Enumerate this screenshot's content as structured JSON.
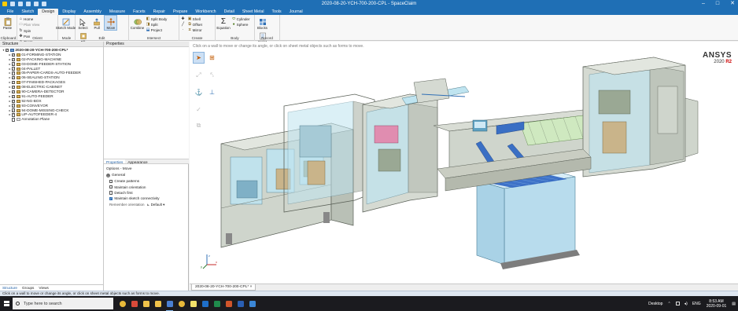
{
  "window": {
    "title": "2020-08-20-YCH-700-200-CPL - SpaceClaim",
    "controls": {
      "minimize": "–",
      "maximize": "□",
      "close": "✕"
    }
  },
  "menu_tabs": [
    "File",
    "Sketch",
    "Design",
    "Display",
    "Assembly",
    "Measure",
    "Facets",
    "Repair",
    "Prepare",
    "Workbench",
    "Detail",
    "Sheet Metal",
    "Tools",
    "Journal"
  ],
  "ribbon": {
    "clipboard": {
      "paste": "Paste",
      "label": "Clipboard"
    },
    "orient": {
      "home": "Home",
      "plan_view": "Plan View",
      "spin": "Spin",
      "pan": "Pan",
      "zoom": "Zoom",
      "label": "Orient"
    },
    "mode": {
      "sketch_mode": "Sketch Mode",
      "label": "Mode"
    },
    "edit": {
      "select": "Select",
      "pull": "Pull",
      "move": "Move",
      "fill": "Fill",
      "label": "Edit"
    },
    "intersect": {
      "combine": "Combine",
      "split_body": "Split Body",
      "split": "Split",
      "project": "Project",
      "label": "Intersect"
    },
    "create": {
      "shell": "Shell",
      "offset": "Offset",
      "mirror": "Mirror",
      "label": "Create"
    },
    "body": {
      "equation": "Equation",
      "cylinder": "Cylinder",
      "sphere": "Sphere",
      "label": "Body"
    },
    "record": {
      "blocks": "Blocks",
      "script": "Script",
      "label": "Record"
    }
  },
  "structure": {
    "header": "Structure",
    "root": "2020-08-20-YCH-700-200-CPL*",
    "items": [
      "01-FORMING-STATION",
      "02-PACKING-MACHINE",
      "03-DOME-FEEDER-STATION",
      "04-PALLET",
      "05-PAPER-CARDS-AUTO-FEEDER",
      "06-SEALING-STATION",
      "07-FINISHED-PACKAGES",
      "08-ELECTRIC-CABINET",
      "90-CAMERA-DETECTOR",
      "91-AUTO-FEEDER",
      "92-NG-BOX",
      "93-CONVEYOR",
      "94-DOME-MISSING-CHECK",
      "LIP-AUTOFEEDER-4"
    ],
    "annotation_plane": "Annotation Plane",
    "bottom_tabs": [
      "Structure",
      "Groups",
      "Views"
    ]
  },
  "properties": {
    "header": "Properties",
    "tabs": [
      "Properties",
      "Appearance"
    ],
    "options_title": "Options - Move",
    "general": "General",
    "options": [
      {
        "label": "Create patterns",
        "checked": false
      },
      {
        "label": "Maintain orientation",
        "checked": false
      },
      {
        "label": "Detach first",
        "checked": false
      },
      {
        "label": "Maintain sketch connectivity",
        "checked": true
      }
    ],
    "remember_label": "Remember orientation",
    "remember_value": "Default"
  },
  "viewport": {
    "hint": "Click on a wall to move or change its angle, or click on sheet metal objects such as forms to move.",
    "brand": "ANSYS",
    "version_year": "2020",
    "version_release": "R2",
    "triad_axes": [
      "x",
      "y",
      "z"
    ]
  },
  "document_tab": "2020-08-20-YCH-700-200-CPL*",
  "status_text": "Click on a wall to move or change its angle, or click on sheet metal objects such as forms to move.",
  "taskbar": {
    "search_placeholder": "Type here to search",
    "apps": [
      "chrome-icon",
      "media-icon",
      "explorer-icon",
      "folder-icon",
      "spaceclaim-icon",
      "chrome-icon",
      "notes-icon",
      "outlook-icon",
      "excel-icon",
      "ppt-icon",
      "word-icon",
      "mail-icon"
    ],
    "desktop": "Desktop",
    "language": "ENG",
    "time": "8:53 AM",
    "date": "2020-09-01"
  },
  "colors": {
    "titlebar": "#1f6fb5",
    "accent": "#2f6fb5",
    "frame": "#c9cdc2",
    "glass": "#bfe4f0",
    "version_red": "#cc0000"
  }
}
